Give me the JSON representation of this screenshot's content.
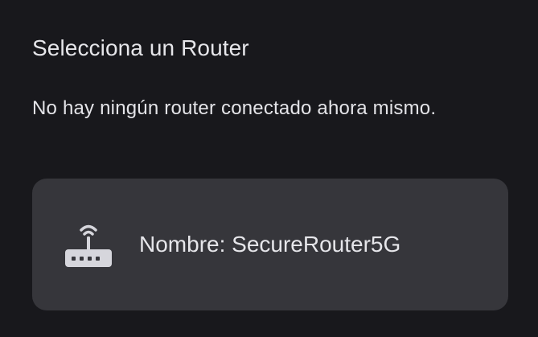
{
  "dialog": {
    "title": "Selecciona un Router",
    "message": "No hay ningún router conectado ahora mismo.",
    "routers": [
      {
        "name_label": "Nombre: SecureRouter5G",
        "icon": "router-icon"
      }
    ]
  },
  "colors": {
    "background": "#18181c",
    "card": "#36363b",
    "text": "#e6e6ea",
    "icon": "#d6d6dc"
  }
}
